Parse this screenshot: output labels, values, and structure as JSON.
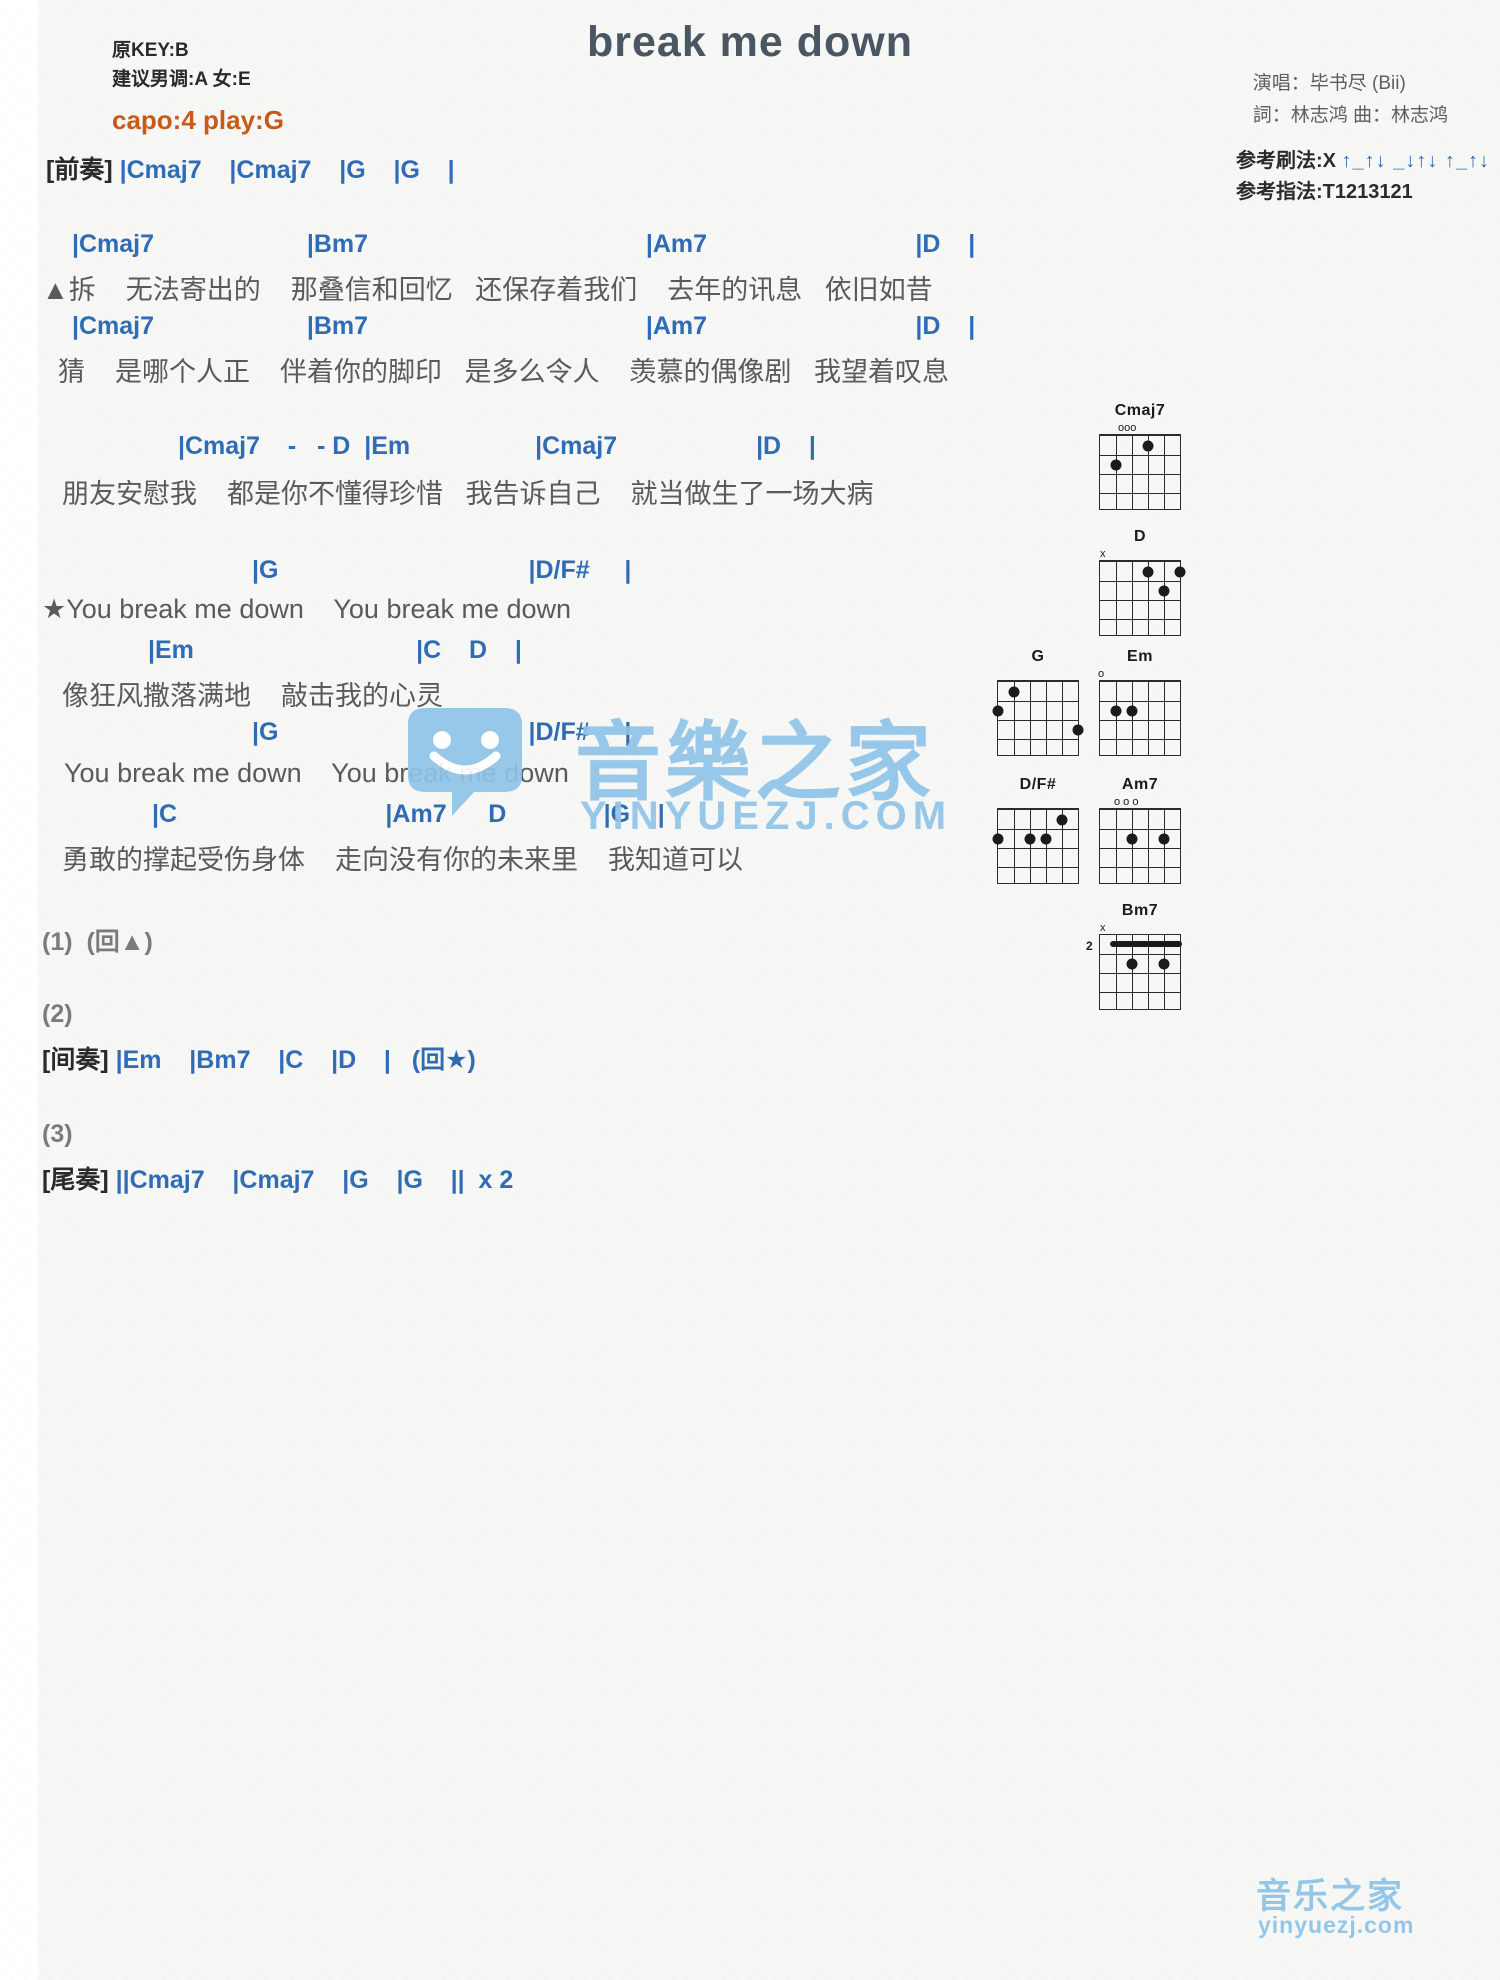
{
  "title": "break me down",
  "header": {
    "original_key": "原KEY:B",
    "suggested_key": "建议男调:A 女:E",
    "capo": "capo:4 play:G",
    "singer": "演唱：毕书尽 (Bii)",
    "credits": "詞：林志鸿   曲：林志鸿",
    "strum_label": "参考刷法:X",
    "strum_pattern": "↑_↑↓ _↓↑↓ ↑_↑↓",
    "finger_label": "参考指法:T1213121"
  },
  "sections": {
    "intro_label": "[前奏]",
    "intro_chords": "|Cmaj7    |Cmaj7    |G    |G    |",
    "verse1": {
      "chords_line1": "|Cmaj7                      |Bm7                                        |Am7                              |D    |",
      "lyrics_line1": "▲拆    无法寄出的    那叠信和回忆   还保存着我们    去年的讯息   依旧如昔",
      "chords_line2": "|Cmaj7                      |Bm7                                        |Am7                              |D    |",
      "lyrics_line2": "猜    是哪个人正    伴着你的脚印   是多么令人    羡慕的偶像剧   我望着叹息"
    },
    "pre_chorus": {
      "chords": "|Cmaj7    -   - D  |Em                  |Cmaj7                    |D    |",
      "lyrics": "朋友安慰我    都是你不懂得珍惜   我告诉自己    就当做生了一场大病"
    },
    "chorus": {
      "chords_line1": "|G                                    |D/F#     |",
      "lyrics_line1": "★You break me down    You break me down",
      "chords_line2": "|Em                                |C    D    |",
      "lyrics_line2": "像狂风撒落满地    敲击我的心灵",
      "chords_line3": "|G                                    |D/F#     |",
      "lyrics_line3": "You break me down    You break me down",
      "chords_line4": "|C                              |Am7      D              |G    |",
      "lyrics_line4": "勇敢的撑起受伤身体    走向没有你的未来里    我知道可以"
    },
    "repeat1": "(1)  (回▲)",
    "repeat2_num": "(2)",
    "interlude_label": "[间奏]",
    "interlude_chords": "|Em    |Bm7    |C    |D    |   (回★)",
    "repeat3_num": "(3)",
    "outro_label": "[尾奏]",
    "outro_chords": "||Cmaj7    |Cmaj7    |G    |G    ||  x 2"
  },
  "chord_diagrams": [
    {
      "name": "Cmaj7",
      "top_marks": "ooo"
    },
    {
      "name": "D",
      "top_marks": "x"
    },
    {
      "name": "G",
      "top_marks": ""
    },
    {
      "name": "Em",
      "top_marks": "o"
    },
    {
      "name": "D/F#",
      "top_marks": ""
    },
    {
      "name": "Am7",
      "top_marks": "o o o"
    },
    {
      "name": "Bm7",
      "top_marks": "x",
      "fret": "2"
    }
  ],
  "watermark": {
    "brand_cn": "音樂之家",
    "brand_sub": "YINYUEZJ.COM",
    "bottom_cn": "音乐之家",
    "bottom_sub": "yinyuezj.com"
  },
  "colors": {
    "chord": "#2f6cb5",
    "bar": "#b5541f",
    "capo": "#c85a18",
    "lyric": "#5a5a5a",
    "watermark": "#8fc4e8"
  }
}
